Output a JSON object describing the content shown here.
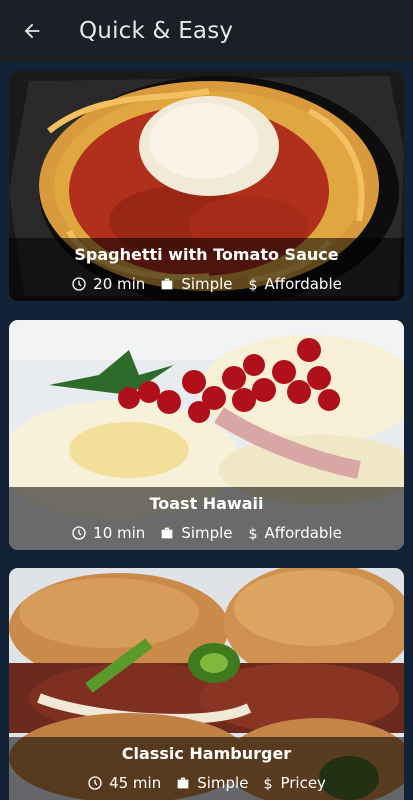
{
  "appbar": {
    "title": "Quick & Easy",
    "back_icon": "arrow-left-icon"
  },
  "colors": {
    "appbar": "#1c1f26",
    "background": "#122237",
    "overlay": "rgba(0,0,0,0.55)",
    "text": "#ffffff"
  },
  "meals": [
    {
      "title": "Spaghetti with Tomato Sauce",
      "duration": "20 min",
      "complexity": "Simple",
      "affordability": "Affordable"
    },
    {
      "title": "Toast Hawaii",
      "duration": "10 min",
      "complexity": "Simple",
      "affordability": "Affordable"
    },
    {
      "title": "Classic Hamburger",
      "duration": "45 min",
      "complexity": "Simple",
      "affordability": "Pricey"
    }
  ]
}
